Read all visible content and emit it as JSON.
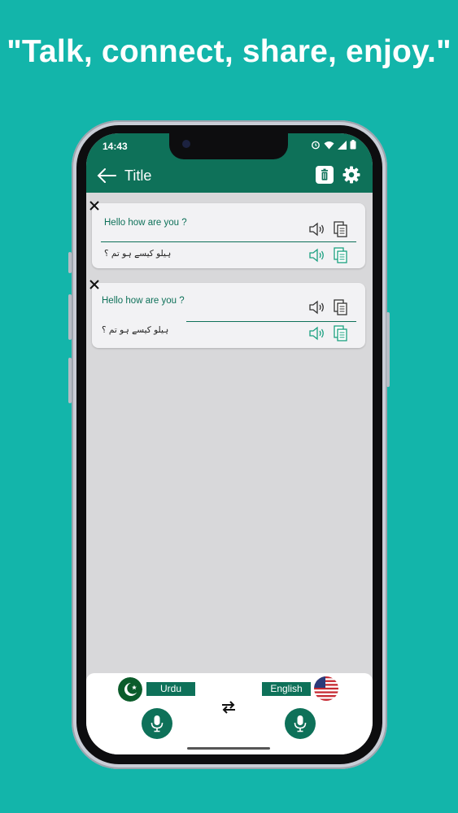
{
  "headline": "\"Talk, connect, share, enjoy.\"",
  "status": {
    "time": "14:43"
  },
  "appbar": {
    "title": "Title"
  },
  "conversations": [
    {
      "source": "Hello how are you ?",
      "translation": "ہیلو کیسے ہو تم ؟"
    },
    {
      "source": "Hello how are you ?",
      "translation": "ہیلو کیسے ہو تم ؟"
    }
  ],
  "languages": {
    "left": "Urdu",
    "right": "English"
  },
  "colors": {
    "background": "#13b5aa",
    "primary": "#0e7159"
  },
  "icons": [
    "back-arrow-icon",
    "trash-icon",
    "gear-icon",
    "close-icon",
    "speaker-icon",
    "copy-icon",
    "swap-icon",
    "mic-icon"
  ]
}
